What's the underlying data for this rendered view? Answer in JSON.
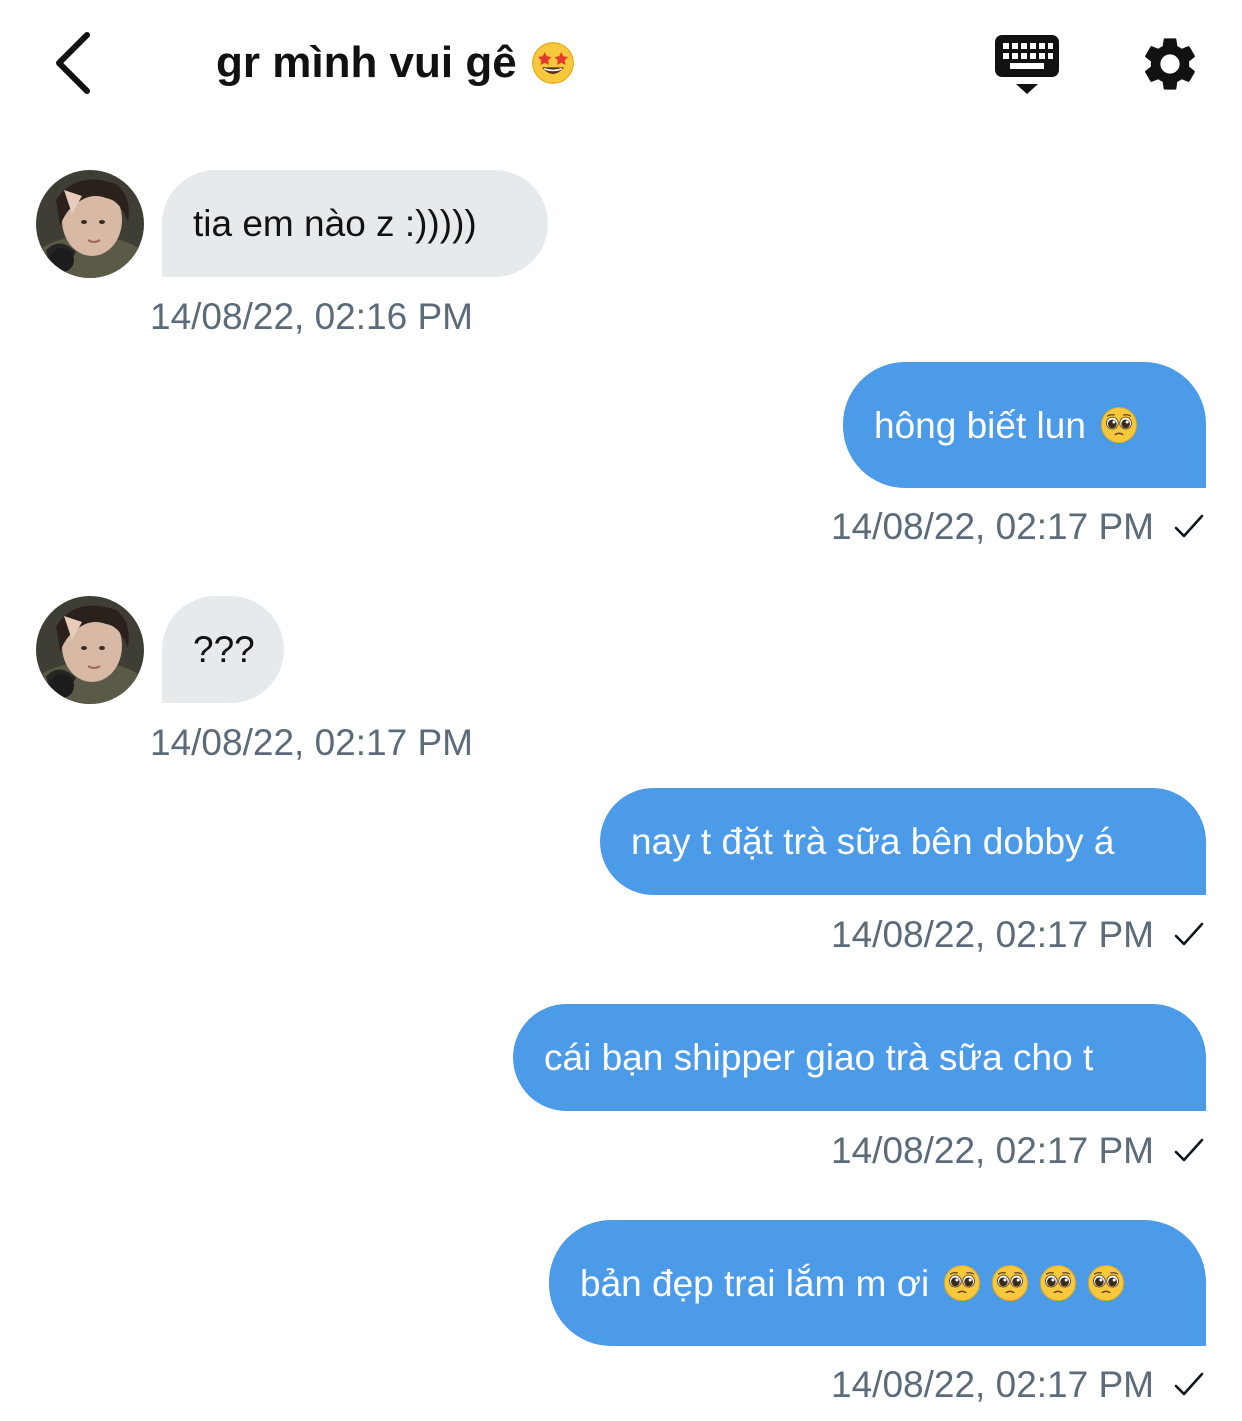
{
  "header": {
    "title": "gr mình vui gê",
    "title_emoji": "star-struck-emoji"
  },
  "colors": {
    "incoming_bubble": "#e7eaed",
    "outgoing_bubble": "#4c9be8",
    "timestamp": "#5b6b79"
  },
  "messages": [
    {
      "direction": "incoming",
      "text": "tia em nào z :)))))",
      "time": "14/08/22, 02:16 PM"
    },
    {
      "direction": "outgoing",
      "text": "hông biết lun",
      "emojis": [
        "pleading-face-emoji"
      ],
      "time": "14/08/22, 02:17 PM",
      "status": "sent"
    },
    {
      "direction": "incoming",
      "text": "???",
      "time": "14/08/22, 02:17 PM"
    },
    {
      "direction": "outgoing",
      "text": "nay t đặt trà sữa bên dobby á",
      "time": "14/08/22, 02:17 PM",
      "status": "sent"
    },
    {
      "direction": "outgoing",
      "text": "cái bạn shipper giao trà sữa cho t",
      "time": "14/08/22, 02:17 PM",
      "status": "sent"
    },
    {
      "direction": "outgoing",
      "text": "bản đẹp trai lắm m ơi",
      "emojis": [
        "pleading-face-emoji",
        "pleading-face-emoji",
        "pleading-face-emoji",
        "pleading-face-emoji"
      ],
      "time": "14/08/22, 02:17 PM",
      "status": "sent"
    }
  ]
}
